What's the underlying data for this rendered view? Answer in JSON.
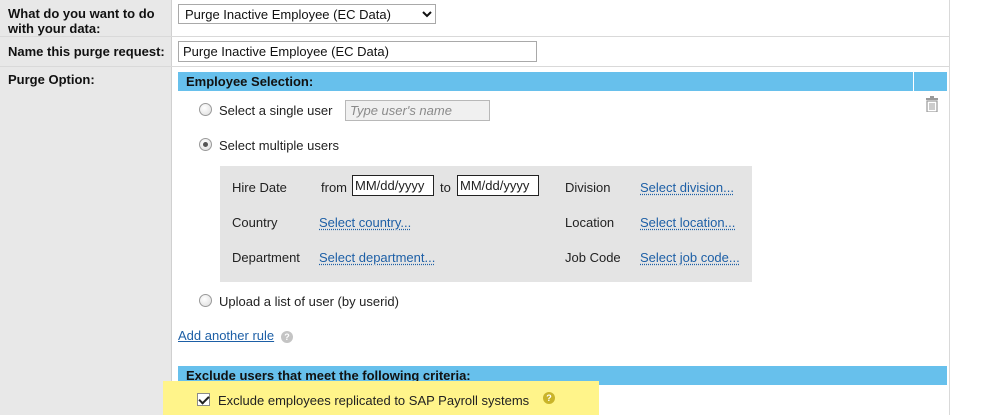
{
  "rows": {
    "action_label": "What do you want to do with your data:",
    "name_label": "Name this purge request:",
    "option_label": "Purge Option:"
  },
  "action_select": {
    "selected": "Purge Inactive Employee (EC Data)"
  },
  "request_name": {
    "value": "Purge Inactive Employee (EC Data)"
  },
  "employee_selection": {
    "header": "Employee Selection:",
    "single_user_label": "Select a single user",
    "single_user_placeholder": "Type user's name",
    "multiple_users_label": "Select multiple users",
    "upload_label": "Upload a list of user (by userid)",
    "selected_option": "multiple"
  },
  "criteria": {
    "hire_date_label": "Hire Date",
    "from_label": "from",
    "from_placeholder": "MM/dd/yyyy",
    "to_label": "to",
    "to_placeholder": "MM/dd/yyyy",
    "division_label": "Division",
    "division_link": "Select division...",
    "country_label": "Country",
    "country_link": "Select country...",
    "location_label": "Location",
    "location_link": "Select location...",
    "department_label": "Department",
    "department_link": "Select department...",
    "job_code_label": "Job Code",
    "job_code_link": "Select job code..."
  },
  "add_rule_label": "Add another rule",
  "exclude": {
    "header": "Exclude users that meet the following criteria:",
    "checkbox_label": "Exclude employees replicated to SAP Payroll systems",
    "checked": true
  },
  "colors": {
    "header_blue": "#67c0ec",
    "highlight_yellow": "#fff48a",
    "link_blue": "#1d5fa6",
    "label_gray": "#e8e8e8"
  },
  "icons": {
    "delete": "trash-icon",
    "help": "help-icon",
    "dropdown": "chevron-down-icon"
  }
}
